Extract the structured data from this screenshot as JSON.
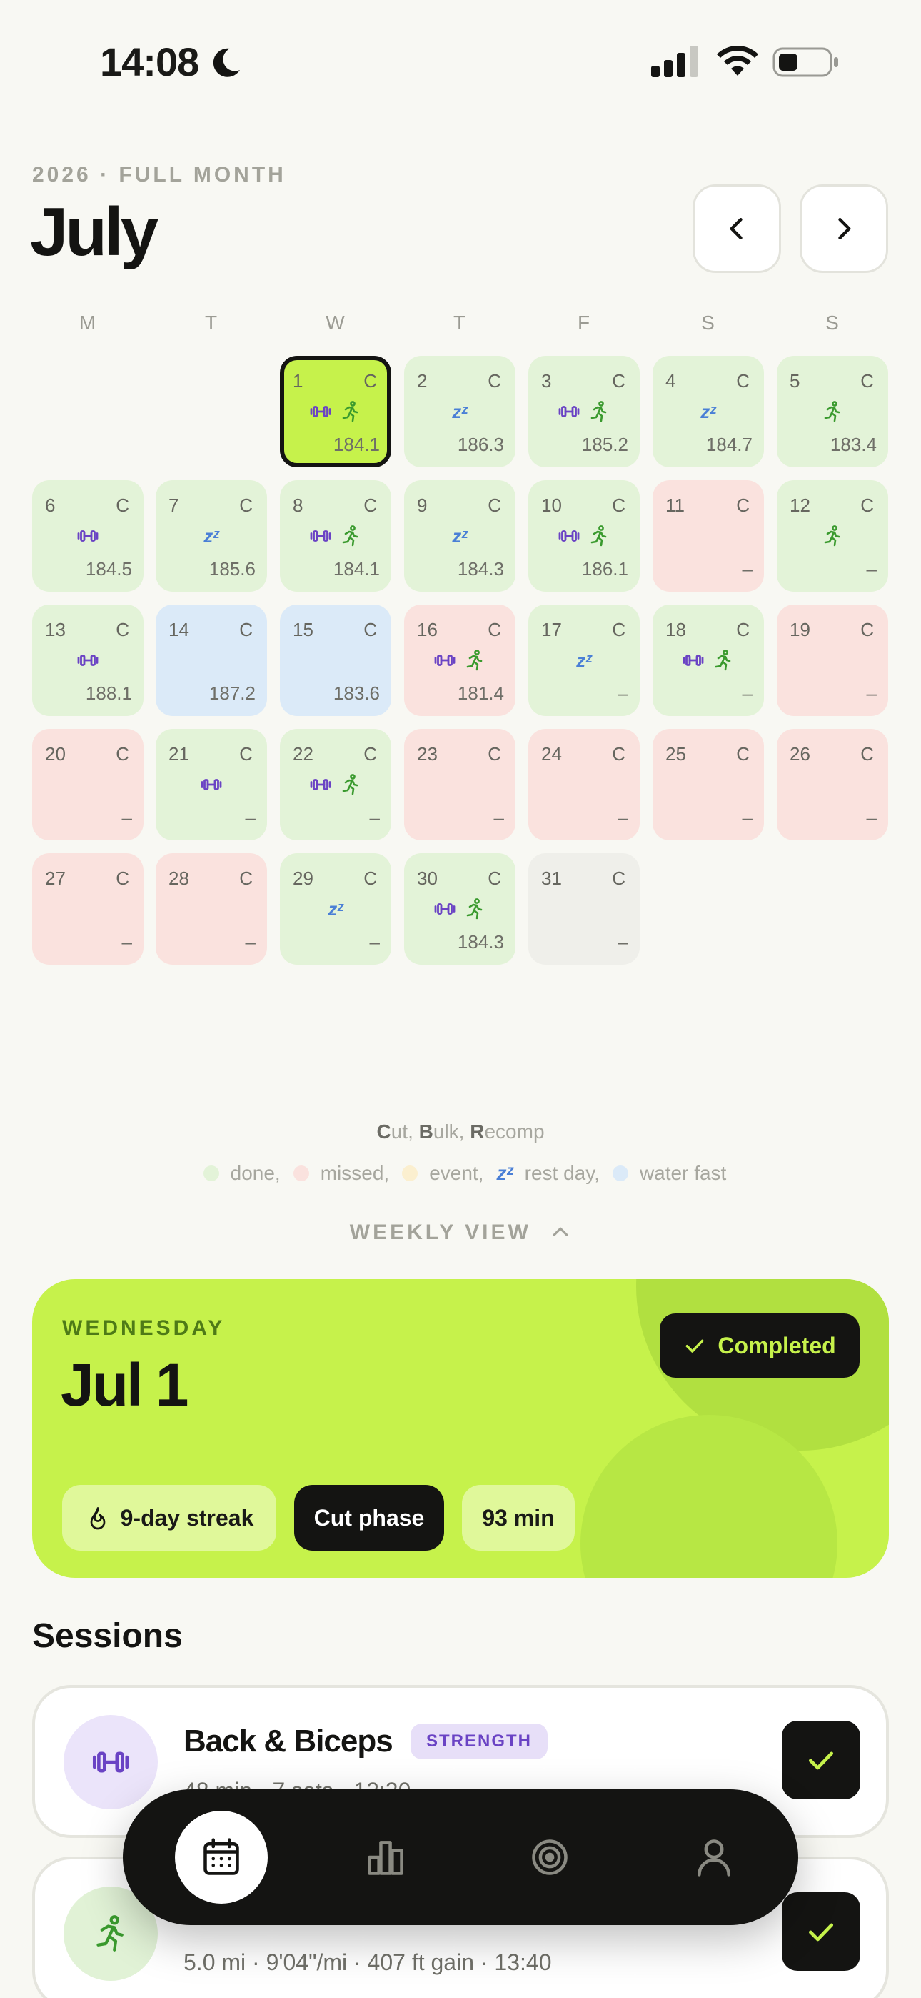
{
  "status_bar": {
    "time": "14:08"
  },
  "header": {
    "eyebrow": "2026 · FULL MONTH",
    "month": "July"
  },
  "weekdays": [
    "M",
    "T",
    "W",
    "T",
    "F",
    "S",
    "S"
  ],
  "calendar": {
    "days": [
      {
        "day": "1",
        "phase": "C",
        "status": "today",
        "icons": [
          "dumbbell",
          "run"
        ],
        "weight": "184.1"
      },
      {
        "day": "2",
        "phase": "C",
        "status": "done",
        "icons": [
          "zz"
        ],
        "weight": "186.3"
      },
      {
        "day": "3",
        "phase": "C",
        "status": "done",
        "icons": [
          "dumbbell",
          "run"
        ],
        "weight": "185.2"
      },
      {
        "day": "4",
        "phase": "C",
        "status": "done",
        "icons": [
          "zz"
        ],
        "weight": "184.7"
      },
      {
        "day": "5",
        "phase": "C",
        "status": "done",
        "icons": [
          "run"
        ],
        "weight": "183.4"
      },
      {
        "day": "6",
        "phase": "C",
        "status": "done",
        "icons": [
          "dumbbell"
        ],
        "weight": "184.5"
      },
      {
        "day": "7",
        "phase": "C",
        "status": "done",
        "icons": [
          "zz"
        ],
        "weight": "185.6"
      },
      {
        "day": "8",
        "phase": "C",
        "status": "done",
        "icons": [
          "dumbbell",
          "run"
        ],
        "weight": "184.1"
      },
      {
        "day": "9",
        "phase": "C",
        "status": "done",
        "icons": [
          "zz"
        ],
        "weight": "184.3"
      },
      {
        "day": "10",
        "phase": "C",
        "status": "done",
        "icons": [
          "dumbbell",
          "run"
        ],
        "weight": "186.1"
      },
      {
        "day": "11",
        "phase": "C",
        "status": "missed",
        "icons": [],
        "weight": "–"
      },
      {
        "day": "12",
        "phase": "C",
        "status": "done",
        "icons": [
          "run"
        ],
        "weight": "–"
      },
      {
        "day": "13",
        "phase": "C",
        "status": "done",
        "icons": [
          "dumbbell"
        ],
        "weight": "188.1"
      },
      {
        "day": "14",
        "phase": "C",
        "status": "fast",
        "icons": [],
        "weight": "187.2"
      },
      {
        "day": "15",
        "phase": "C",
        "status": "fast",
        "icons": [],
        "weight": "183.6"
      },
      {
        "day": "16",
        "phase": "C",
        "status": "missed",
        "icons": [
          "dumbbell",
          "run"
        ],
        "weight": "181.4"
      },
      {
        "day": "17",
        "phase": "C",
        "status": "done",
        "icons": [
          "zz"
        ],
        "weight": "–"
      },
      {
        "day": "18",
        "phase": "C",
        "status": "done",
        "icons": [
          "dumbbell",
          "run"
        ],
        "weight": "–"
      },
      {
        "day": "19",
        "phase": "C",
        "status": "missed",
        "icons": [],
        "weight": "–"
      },
      {
        "day": "20",
        "phase": "C",
        "status": "missed",
        "icons": [],
        "weight": "–"
      },
      {
        "day": "21",
        "phase": "C",
        "status": "done",
        "icons": [
          "dumbbell"
        ],
        "weight": "–"
      },
      {
        "day": "22",
        "phase": "C",
        "status": "done",
        "icons": [
          "dumbbell",
          "run"
        ],
        "weight": "–"
      },
      {
        "day": "23",
        "phase": "C",
        "status": "missed",
        "icons": [],
        "weight": "–"
      },
      {
        "day": "24",
        "phase": "C",
        "status": "missed",
        "icons": [],
        "weight": "–"
      },
      {
        "day": "25",
        "phase": "C",
        "status": "missed",
        "icons": [],
        "weight": "–"
      },
      {
        "day": "26",
        "phase": "C",
        "status": "missed",
        "icons": [],
        "weight": "–"
      },
      {
        "day": "27",
        "phase": "C",
        "status": "missed",
        "icons": [],
        "weight": "–"
      },
      {
        "day": "28",
        "phase": "C",
        "status": "missed",
        "icons": [],
        "weight": "–"
      },
      {
        "day": "29",
        "phase": "C",
        "status": "done",
        "icons": [
          "zz"
        ],
        "weight": "–"
      },
      {
        "day": "30",
        "phase": "C",
        "status": "done",
        "icons": [
          "dumbbell",
          "run"
        ],
        "weight": "184.3"
      },
      {
        "day": "31",
        "phase": "C",
        "status": "empty",
        "icons": [],
        "weight": "–"
      }
    ]
  },
  "legend": {
    "phases": [
      {
        "letter": "C",
        "rest": "ut"
      },
      {
        "letter": "B",
        "rest": "ulk"
      },
      {
        "letter": "R",
        "rest": "ecomp"
      }
    ],
    "items": [
      {
        "kind": "dot",
        "color": "#e3f3d8",
        "label": "done,"
      },
      {
        "kind": "dot",
        "color": "#fae2de",
        "label": "missed,"
      },
      {
        "kind": "dot",
        "color": "#fbefcf",
        "label": "event,"
      },
      {
        "kind": "zz",
        "label": "rest day,"
      },
      {
        "kind": "dot",
        "color": "#dbeaf8",
        "label": "water fast"
      }
    ],
    "zz": "zᶻ"
  },
  "weekly_toggle": {
    "label": "WEEKLY VIEW"
  },
  "hero": {
    "weekday": "WEDNESDAY",
    "date": "Jul 1",
    "status": "Completed",
    "pills": {
      "streak": "9-day streak",
      "phase": "Cut phase",
      "duration": "93 min"
    }
  },
  "sessions": {
    "title": "Sessions",
    "items": [
      {
        "title": "Back & Biceps",
        "tag": "STRENGTH",
        "meta": "48 min · 7 sets · 12:30"
      },
      {
        "title": "",
        "tag": "",
        "meta": "5.0 mi · 9'04\"/mi · 407 ft gain · 13:40"
      }
    ]
  },
  "colors": {
    "accent": "#c6f24b",
    "done": "#e3f3d8",
    "missed": "#fae2de",
    "fast": "#dbeaf8",
    "strength": "#6a43c4",
    "cardio": "#3a9a2e"
  }
}
